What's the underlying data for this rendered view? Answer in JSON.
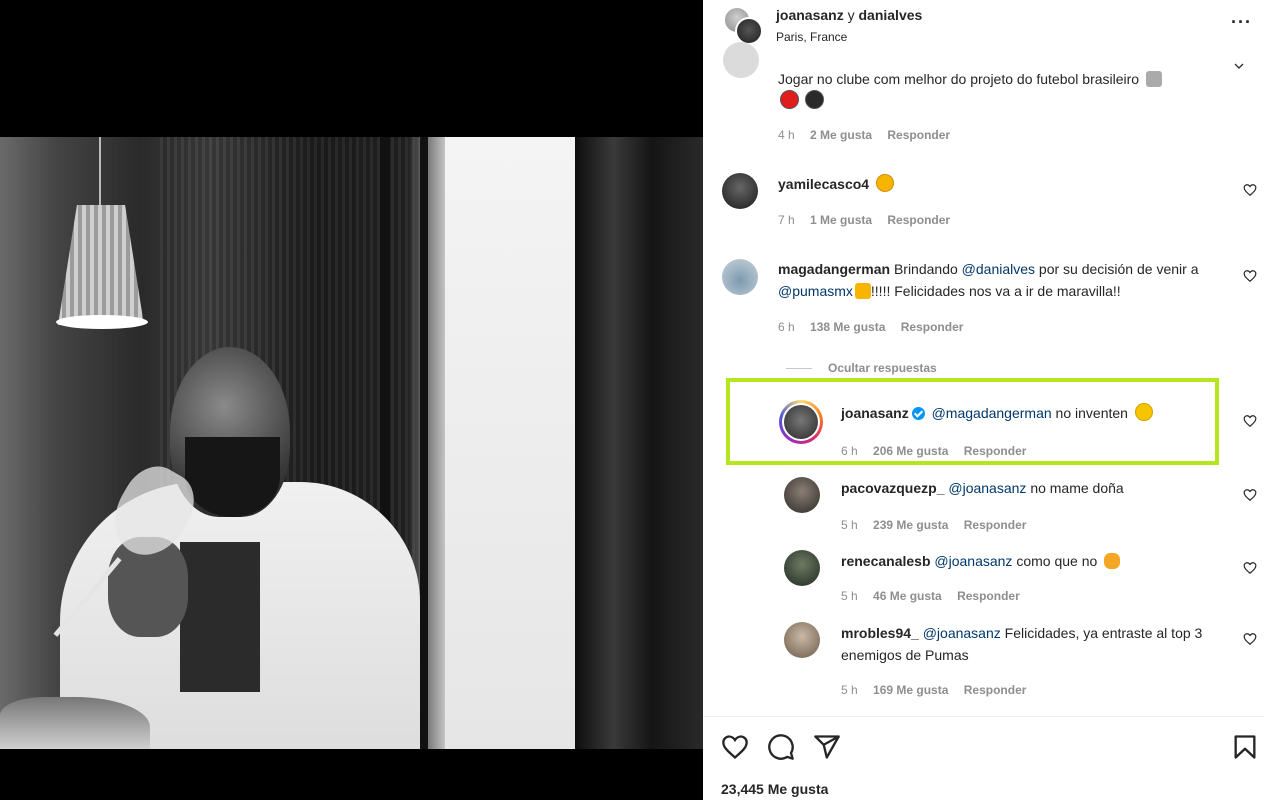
{
  "post": {
    "header": {
      "user1": "joanasanz",
      "conjunction": "y",
      "user2": "danialves",
      "location": "Paris, France",
      "more_icon": "more-horizontal-icon"
    },
    "comments": [
      {
        "id": "c0",
        "username": "",
        "text": "Jogar no clube com melhor do projeto do futebol brasileiro",
        "emoji": [
          "tornado",
          "red-circle",
          "black-circle"
        ],
        "time": "4 h",
        "likes": "2 Me gusta",
        "reply": "Responder"
      },
      {
        "id": "c1",
        "username": "yamilecasco4",
        "text": "",
        "emoji": [
          "star-struck"
        ],
        "time": "7 h",
        "likes": "1 Me gusta",
        "reply": "Responder"
      },
      {
        "id": "c2",
        "username": "magadangerman",
        "text_pre": "Brindando",
        "mention1": "@danialves",
        "text_mid": "por su decisión de",
        "text_line2_pre": "venir a",
        "mention2": "@pumasmx",
        "text_post": "!!!!! Felicidades nos va a ir de maravilla!!",
        "time": "6 h",
        "likes": "138 Me gusta",
        "reply": "Responder"
      }
    ],
    "hide_replies": "Ocultar respuestas",
    "replies": [
      {
        "username": "joanasanz",
        "verified": true,
        "mention": "@magadangerman",
        "text": "no inventen",
        "emoji": "laughing",
        "time": "6 h",
        "likes": "206 Me gusta",
        "reply": "Responder"
      },
      {
        "username": "pacovazquezp_",
        "mention": "@joanasanz",
        "text": "no mame doña",
        "time": "5 h",
        "likes": "239 Me gusta",
        "reply": "Responder"
      },
      {
        "username": "renecanalesb",
        "mention": "@joanasanz",
        "text": "como que no",
        "emoji": "cat-face",
        "time": "5 h",
        "likes": "46 Me gusta",
        "reply": "Responder"
      },
      {
        "username": "mrobles94_",
        "mention": "@joanasanz",
        "text": "Felicidades, ya entraste al top",
        "text_line2": "3 enemigos de Pumas",
        "time": "5 h",
        "likes": "169 Me gusta",
        "reply": "Responder"
      }
    ],
    "actions": {
      "like_icon": "heart-icon",
      "comment_icon": "comment-icon",
      "share_icon": "share-icon",
      "save_icon": "bookmark-icon"
    },
    "total_likes": "23,445 Me gusta",
    "highlight_color": "#b5e51d"
  }
}
